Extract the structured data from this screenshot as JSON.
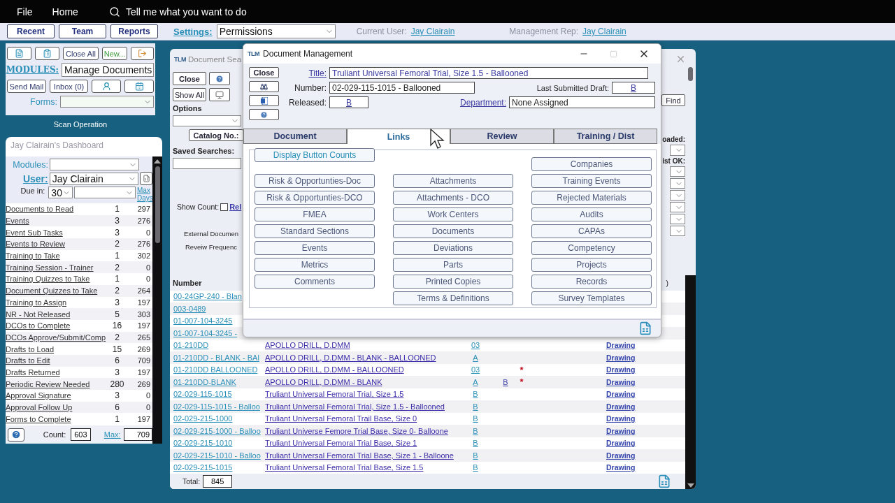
{
  "menu_bar": {
    "items": [
      "File",
      "Home"
    ],
    "tell_me": "Tell me what you want to do"
  },
  "settings_bar": {
    "buttons": [
      "Recent",
      "Team",
      "Reports"
    ],
    "settings_label": "Settings:",
    "settings_value": "Permissions",
    "current_user_label": "Current User:",
    "current_user": "Jay Clairain",
    "management_rep_label": "Management Rep:",
    "management_rep": "Jay Clairain"
  },
  "sidebar": {
    "close_all": "Close All",
    "new": "New...",
    "modules_label": "MODULES:",
    "modules_value": "Manage Documents",
    "send_mail": "Send Mail",
    "inbox": "Inbox (0)",
    "forms_label": "Forms:",
    "scan_operation": "Scan Operation"
  },
  "dashboard": {
    "title": "Jay Clairain's Dashboard",
    "modules_label": "Modules:",
    "user_label": "User:",
    "user_value": "Jay Clairain",
    "due_label": "Due in:",
    "due_value": "30",
    "max_days": "Max Days",
    "items": [
      {
        "label": "Documents to Read",
        "count": "1",
        "max": "297"
      },
      {
        "label": "Events",
        "count": "3",
        "max": "276"
      },
      {
        "label": "Event Sub Tasks",
        "count": "3",
        "max": "0"
      },
      {
        "label": "Events to Review",
        "count": "2",
        "max": "276"
      },
      {
        "label": "Training to Take",
        "count": "1",
        "max": "302"
      },
      {
        "label": "Training Session - Trainer",
        "count": "2",
        "max": "0"
      },
      {
        "label": "Training Quizzes to Take",
        "count": "1",
        "max": "0"
      },
      {
        "label": "Document Quizzes to Take",
        "count": "2",
        "max": "264"
      },
      {
        "label": "Training to Assign",
        "count": "3",
        "max": "197"
      },
      {
        "label": "NR - Not Released",
        "count": "5",
        "max": "303"
      },
      {
        "label": "DCOs to Complete",
        "count": "16",
        "max": "197"
      },
      {
        "label": "DCOs Approve/Submit/Comp",
        "count": "2",
        "max": "265"
      },
      {
        "label": "Drafts to Load",
        "count": "15",
        "max": "269"
      },
      {
        "label": "Drafts to Edit",
        "count": "6",
        "max": "709"
      },
      {
        "label": "Drafts Returned",
        "count": "3",
        "max": "197"
      },
      {
        "label": "Periodic Review Needed",
        "count": "280",
        "max": "269"
      },
      {
        "label": "Approval Signature",
        "count": "3",
        "max": "0"
      },
      {
        "label": "Approval Follow Up",
        "count": "6",
        "max": "0"
      },
      {
        "label": "Forms to Complete",
        "count": "1",
        "max": "197"
      }
    ],
    "count_label": "Count:",
    "count_value": "603",
    "max_label": "Max:",
    "max_value": "709"
  },
  "search_window": {
    "logo": "TLM",
    "title": "Document Sea",
    "close": "Close",
    "show_all": "Show All",
    "options_label": "Options",
    "catalog": "Catalog No.:",
    "saved_searches": "Saved Searches:",
    "show_count": {
      "label": "Show Count:",
      "checked": false
    },
    "rel": "Rel",
    "external": "External Documen",
    "review": "Reveiw Frequenc",
    "find": "Find",
    "loaded": "oaded:",
    "list_ok": "ist OK:",
    "paren": ")",
    "number_header": "Number",
    "rows": [
      {
        "number": "00-24GP-240 - Blan"
      },
      {
        "number": "003-0489"
      },
      {
        "number": "01-007-104-3245"
      },
      {
        "number": "01-007-104-3245 -"
      },
      {
        "number": "01-210DD",
        "description": "APOLLO DRILL, D.DMM",
        "rev": "03",
        "link": "Drawing"
      },
      {
        "number": "01-210DD - BLANK - BAl",
        "description": "APOLLO DRILL, D.DMM - BLANK - BALLOONED",
        "rev": "A",
        "link": "Drawing"
      },
      {
        "number": "01-210DD BALLOONED",
        "description": "APOLLO DRILL, D.DMM - BALLOONED",
        "rev": "03",
        "column_5": "*",
        "link": "Drawing"
      },
      {
        "number": "01-210DD-BLANK",
        "description": "APOLLO DRILL, D.DMM - BLANK",
        "rev": "A",
        "column_4": "B",
        "column_5": "*",
        "link": "Drawing"
      },
      {
        "number": "02-029-115-1015",
        "description": "Truliant Universal Femoral Trial, Size 1.5",
        "rev": "B",
        "link": "Drawing"
      },
      {
        "number": "02-029-115-1015 - Balloo",
        "description": "Truliant Universal Femoral Trial, Size 1.5 - Ballooned",
        "rev": "B",
        "link": "Drawing"
      },
      {
        "number": "02-029-215-1000",
        "description": "Truliant Universal Femoral Trail Base, Size 0",
        "rev": "B",
        "link": "Drawing"
      },
      {
        "number": "02-029-215-1000 - Balloo",
        "description": "Truliant Universe Femore Trial Base, Size 0- Balloone",
        "rev": "B",
        "link": "Drawing"
      },
      {
        "number": "02-029-215-1010",
        "description": "Truliant Universal Femoral Trial Base, Size 1",
        "rev": "B",
        "link": "Drawing"
      },
      {
        "number": "02-029-215-1010 - Balloo",
        "description": "Truliant Universal Femoral Trial Base, Size 1 - Balloone",
        "rev": "B",
        "link": "Drawing"
      },
      {
        "number": "02-029-215-1015",
        "description": "Truliant Universal Femoral Trial Base, Size 1.5",
        "rev": "B",
        "link": "Drawing"
      }
    ],
    "total_label": "Total:",
    "total": "845"
  },
  "dialog": {
    "logo": "TLM",
    "title": "Document Management",
    "close": "Close",
    "title_label": "Title:",
    "title_value": "Truliant Universal Femoral Trial, Size 1.5 - Ballooned",
    "number_label": "Number:",
    "number_value": "02-029-115-1015 - Ballooned",
    "last_draft_label": "Last Submitted Draft:",
    "last_draft_value": "B",
    "released_label": "Released:",
    "released_value": "B",
    "department_label": "Department:",
    "department_value": "None Assigned",
    "tabs": [
      {
        "label": "Document",
        "selected": false
      },
      {
        "label": "Links",
        "selected": true
      },
      {
        "label": "Review",
        "selected": false
      },
      {
        "label": "Training / Dist",
        "selected": false
      }
    ],
    "display_counts": "Display Button Counts",
    "link_columns": [
      [
        "Risk & Opportunties-Doc",
        "Risk & Opportunties-DCO",
        "FMEA",
        "Standard Sections",
        "Events",
        "Metrics",
        "Comments"
      ],
      [
        "Attachments",
        "Attachments - DCO",
        "Work Centers",
        "Documents",
        "Deviations",
        "Parts",
        "Printed Copies",
        "Terms & Definitions"
      ],
      [
        "Companies",
        "Training Events",
        "Rejected Materials",
        "Audits",
        "CAPAs",
        "Competency",
        "Projects",
        "Records",
        "Survey Templates"
      ]
    ]
  }
}
